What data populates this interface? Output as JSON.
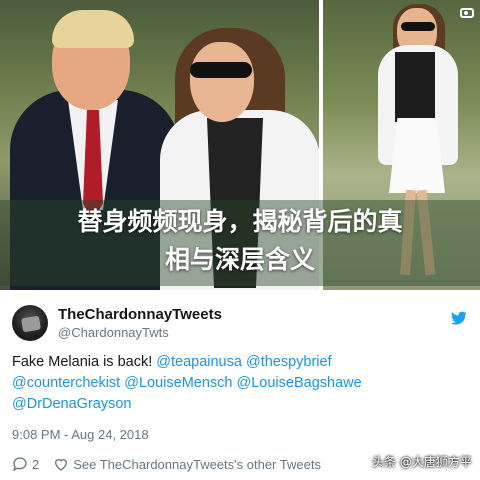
{
  "headline": {
    "line1": "替身频频现身，揭秘背后的真",
    "line2": "相与深层含义"
  },
  "tweet": {
    "display_name": "TheChardonnayTweets",
    "handle": "@ChardonnayTwts",
    "text_prefix": "Fake Melania is back! ",
    "mentions": [
      "@teapainusa",
      "@thespybrief",
      "@counterchekist",
      "@LouiseMensch",
      "@LouiseBagshawe",
      "@DrDenaGrayson"
    ],
    "timestamp": "9:08 PM - Aug 24, 2018",
    "reply_count": "2",
    "see_other": "See TheChardonnayTweets's other Tweets"
  },
  "watermark": "头条 @大唐狮方平",
  "colors": {
    "link": "#1b95e0",
    "text": "#14171a",
    "muted": "#657786",
    "twitter_blue": "#1da1f2"
  },
  "icons": {
    "twitter": "twitter-bird-icon",
    "reply": "reply-icon",
    "like": "heart-icon",
    "camera": "camera-icon"
  }
}
